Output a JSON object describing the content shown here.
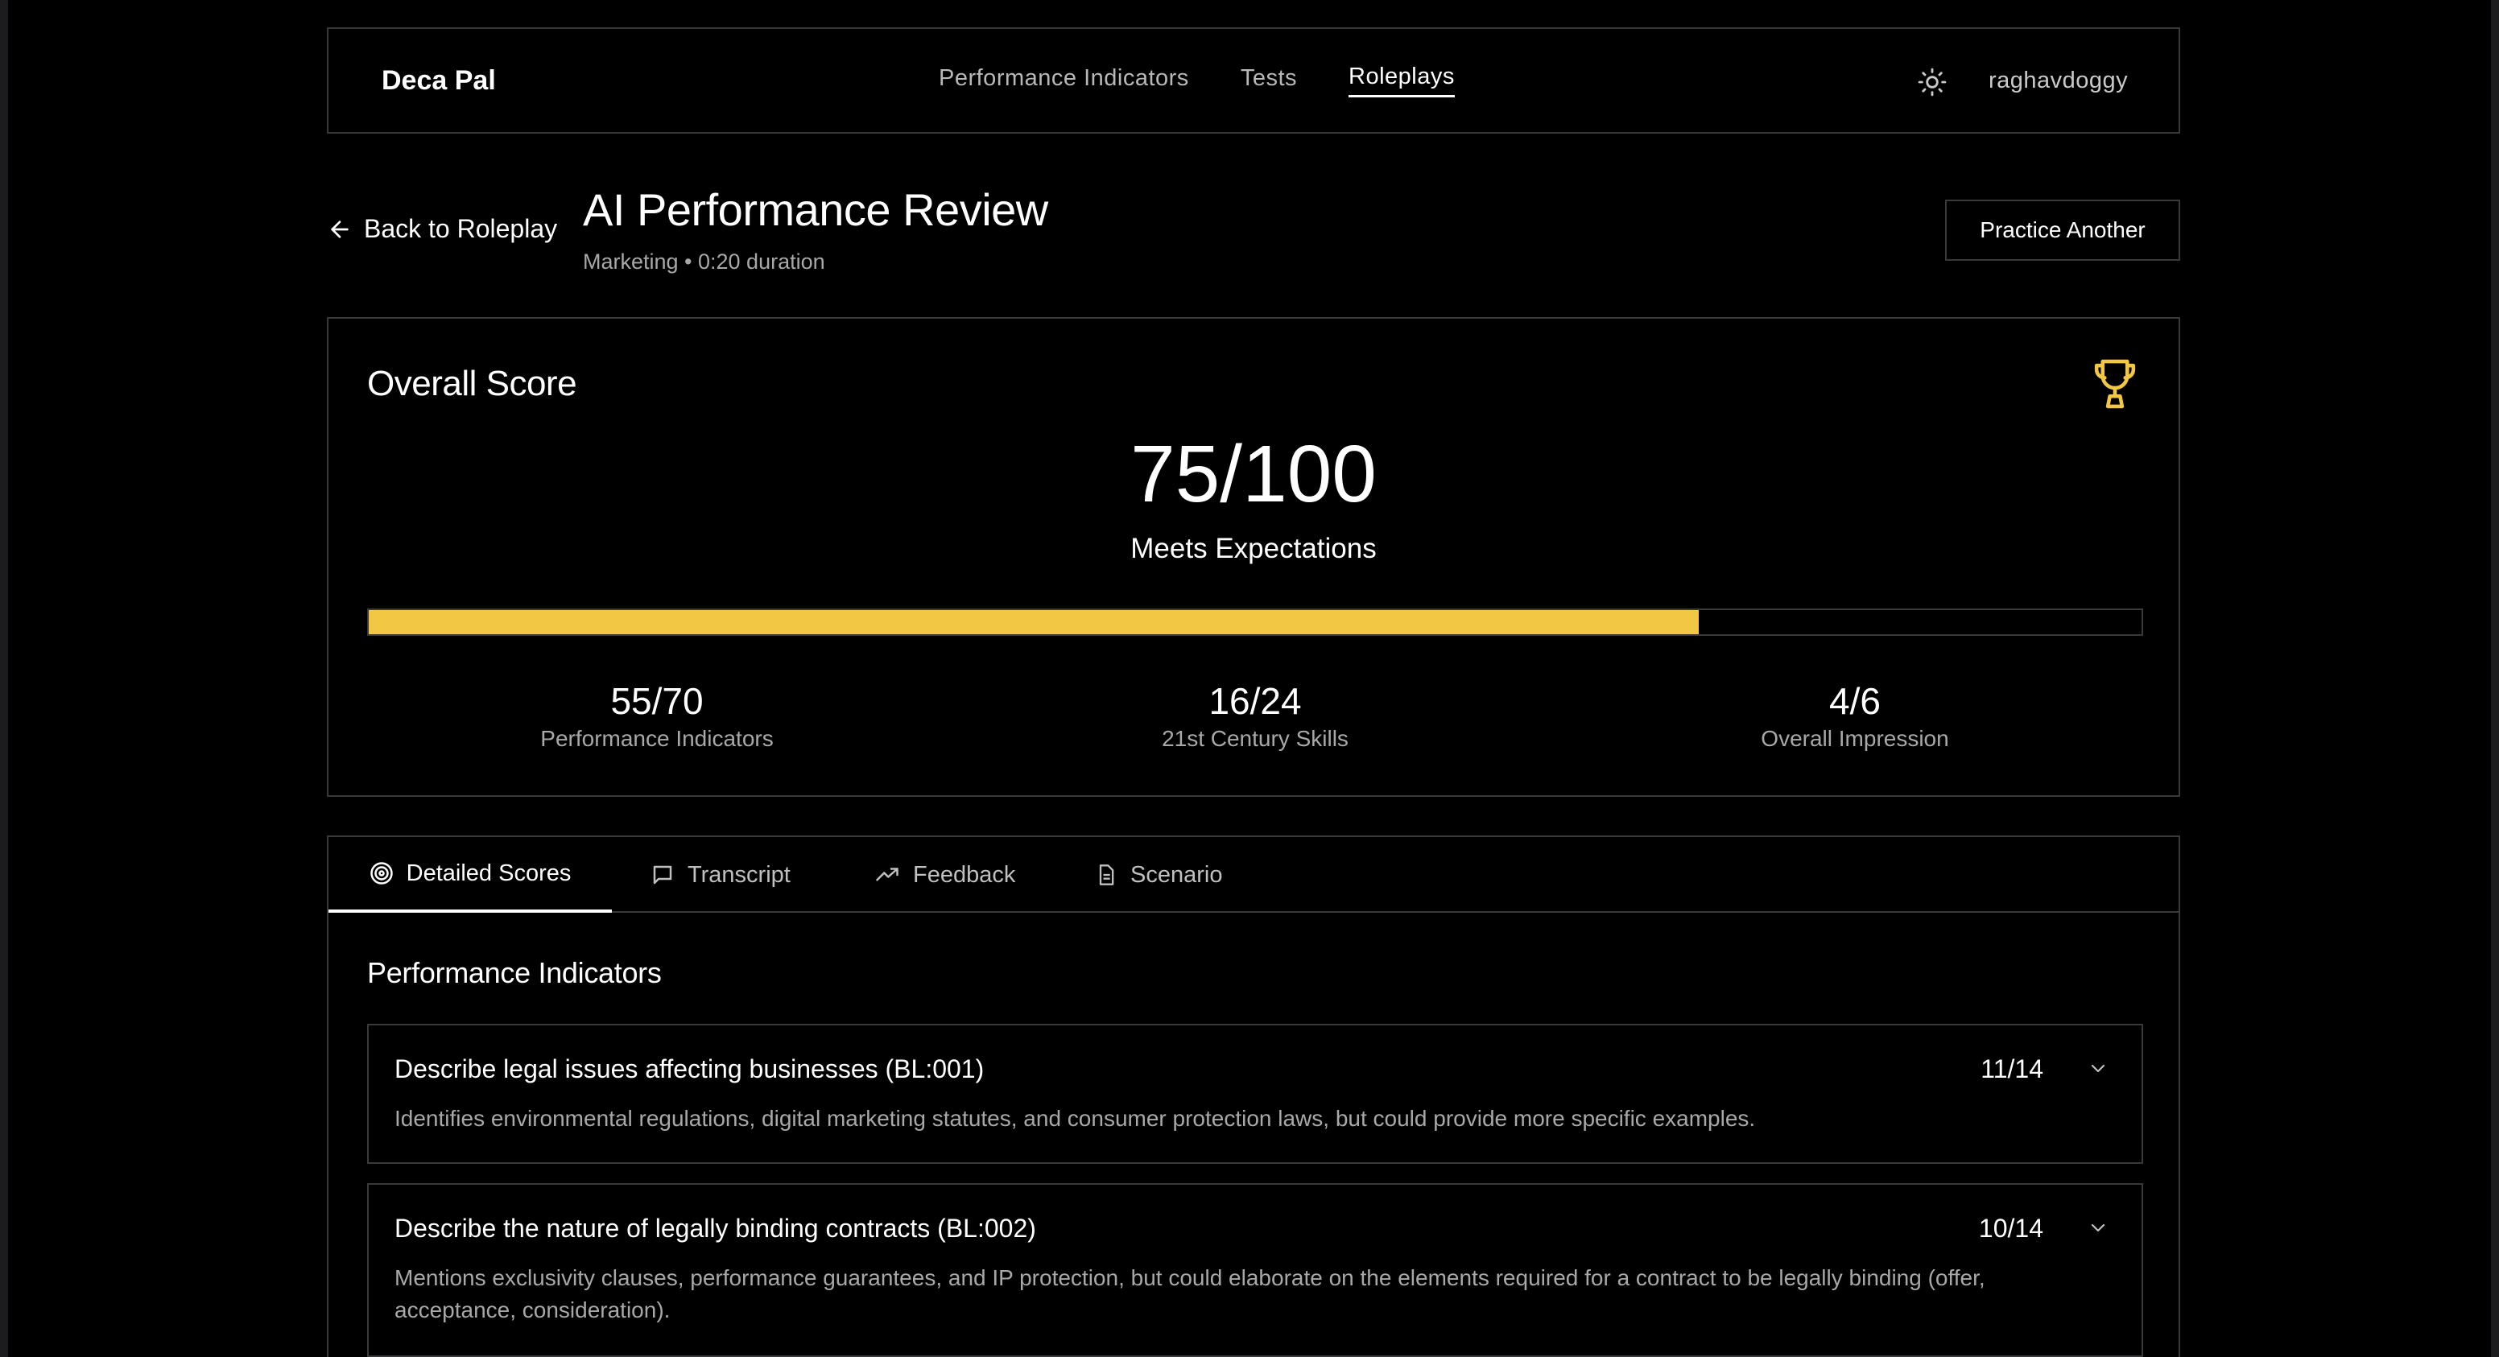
{
  "nav": {
    "brand": "Deca Pal",
    "links": [
      {
        "label": "Performance Indicators",
        "active": false
      },
      {
        "label": "Tests",
        "active": false
      },
      {
        "label": "Roleplays",
        "active": true
      }
    ],
    "theme_icon": "sun-icon",
    "username": "raghavdoggy"
  },
  "header": {
    "back_label": "Back to Roleplay",
    "title": "AI Performance Review",
    "meta": "Marketing • 0:20 duration",
    "practice_label": "Practice Another"
  },
  "overall": {
    "title": "Overall Score",
    "score": "75/100",
    "score_fraction": 0.75,
    "rating": "Meets Expectations",
    "accent_color": "#f2c744",
    "trophy_icon": "trophy-icon",
    "breakdown": [
      {
        "value": "55/70",
        "label": "Performance Indicators"
      },
      {
        "value": "16/24",
        "label": "21st Century Skills"
      },
      {
        "value": "4/6",
        "label": "Overall Impression"
      }
    ]
  },
  "tabs": [
    {
      "label": "Detailed Scores",
      "icon": "target-icon",
      "active": true
    },
    {
      "label": "Transcript",
      "icon": "message-icon",
      "active": false
    },
    {
      "label": "Feedback",
      "icon": "trending-up-icon",
      "active": false
    },
    {
      "label": "Scenario",
      "icon": "document-icon",
      "active": false
    }
  ],
  "detailed": {
    "section_title": "Performance Indicators",
    "items": [
      {
        "title": "Describe legal issues affecting businesses (BL:001)",
        "score": "11/14",
        "description": "Identifies environmental regulations, digital marketing statutes, and consumer protection laws, but could provide more specific examples."
      },
      {
        "title": "Describe the nature of legally binding contracts (BL:002)",
        "score": "10/14",
        "description": "Mentions exclusivity clauses, performance guarantees, and IP protection, but could elaborate on the elements required for a contract to be legally binding (offer, acceptance, consideration)."
      }
    ]
  }
}
